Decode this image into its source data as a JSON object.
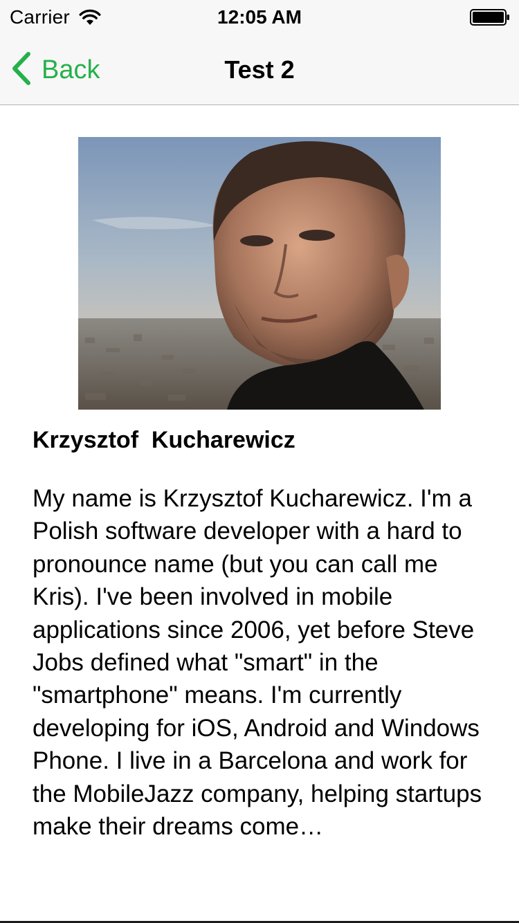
{
  "status_bar": {
    "carrier": "Carrier",
    "time": "12:05 AM",
    "icons": [
      "wifi-icon",
      "battery-icon"
    ]
  },
  "nav": {
    "back_label": "Back",
    "title": "Test 2",
    "back_icon": "chevron-left-icon",
    "accent_color": "#25b14a"
  },
  "profile": {
    "photo_alt": "",
    "name": "Krzysztof  Kucharewicz",
    "bio": "My name is Krzysztof Kucharewicz. I'm a Polish software developer with a hard to pronounce name (but you can call me Kris). I've been involved in mobile applications since 2006, yet before Steve Jobs defined what \"smart\" in the \"smartphone\" means. I'm currently developing for iOS, Android and Windows Phone. I live in a Barcelona and work for the MobileJazz company, helping startups make their dreams come…"
  }
}
